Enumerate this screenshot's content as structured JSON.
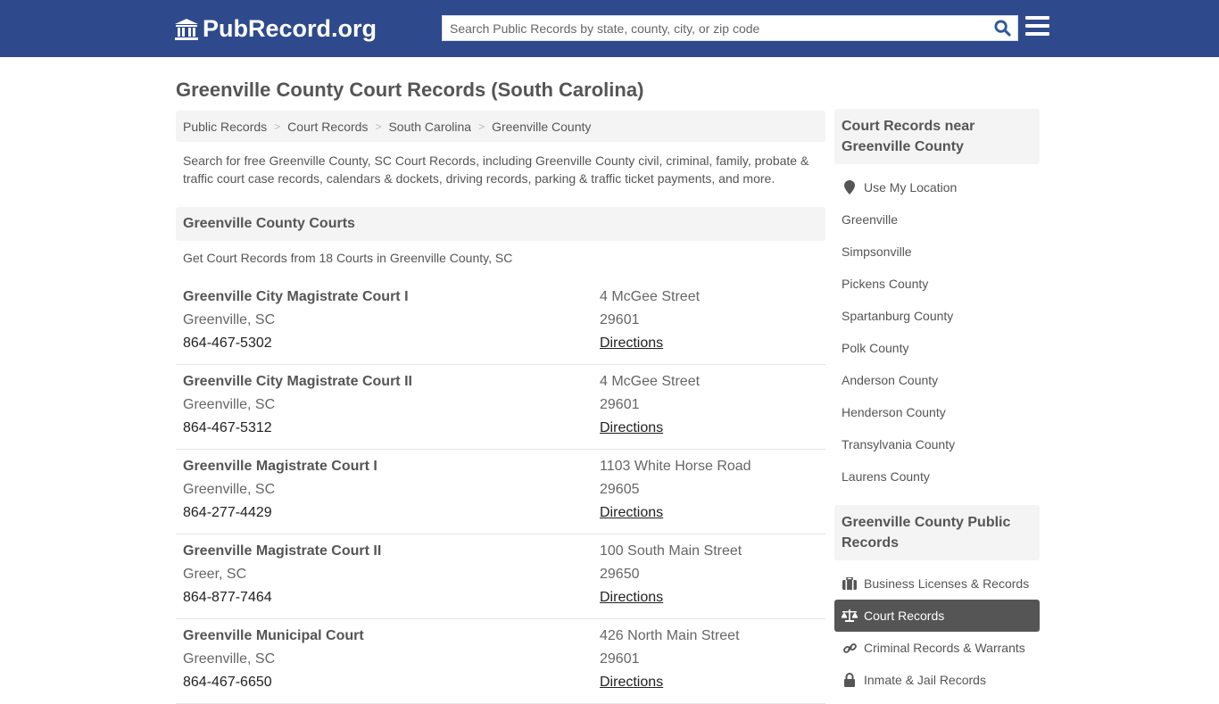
{
  "header": {
    "logo_text": "PubRecord.org",
    "search_placeholder": "Search Public Records by state, county, city, or zip code",
    "brand_color": "#2e4a8c"
  },
  "page": {
    "title": "Greenville County Court Records (South Carolina)",
    "breadcrumb": [
      "Public Records",
      "Court Records",
      "South Carolina",
      "Greenville County"
    ],
    "intro": "Search for free Greenville County, SC Court Records, including Greenville County civil, criminal, family, probate & traffic court case records, calendars & dockets, driving records, parking & traffic ticket payments, and more.",
    "section_title": "Greenville County Courts",
    "section_subtitle": "Get Court Records from 18 Courts in Greenville County, SC"
  },
  "courts": [
    {
      "name": "Greenville City Magistrate Court I",
      "city": "Greenville, SC",
      "phone": "864-467-5302",
      "address": "4 McGee Street",
      "zip": "29601",
      "directions": "Directions"
    },
    {
      "name": "Greenville City Magistrate Court II",
      "city": "Greenville, SC",
      "phone": "864-467-5312",
      "address": "4 McGee Street",
      "zip": "29601",
      "directions": "Directions"
    },
    {
      "name": "Greenville Magistrate Court I",
      "city": "Greenville, SC",
      "phone": "864-277-4429",
      "address": "1103 White Horse Road",
      "zip": "29605",
      "directions": "Directions"
    },
    {
      "name": "Greenville Magistrate Court II",
      "city": "Greer, SC",
      "phone": "864-877-7464",
      "address": "100 South Main Street",
      "zip": "29650",
      "directions": "Directions"
    },
    {
      "name": "Greenville Municipal Court",
      "city": "Greenville, SC",
      "phone": "864-467-6650",
      "address": "426 North Main Street",
      "zip": "29601",
      "directions": "Directions"
    }
  ],
  "sidebar": {
    "nearby_title": "Court Records near Greenville County",
    "use_location": "Use My Location",
    "nearby": [
      "Greenville",
      "Simpsonville",
      "Pickens County",
      "Spartanburg County",
      "Polk County",
      "Anderson County",
      "Henderson County",
      "Transylvania County",
      "Laurens County"
    ],
    "public_title": "Greenville County Public Records",
    "public_items": [
      {
        "label": "Business Licenses & Records",
        "icon": "briefcase-icon"
      },
      {
        "label": "Court Records",
        "icon": "scale-icon",
        "active": true
      },
      {
        "label": "Criminal Records & Warrants",
        "icon": "link-icon"
      },
      {
        "label": "Inmate & Jail Records",
        "icon": "lock-icon"
      }
    ]
  }
}
